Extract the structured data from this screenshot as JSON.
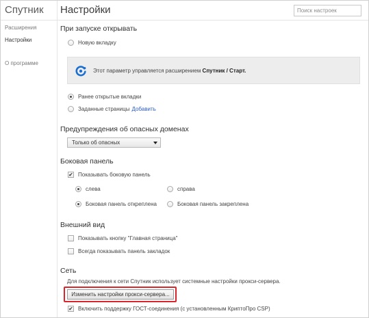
{
  "sidebar": {
    "brand": "Спутник",
    "items": [
      {
        "label": "Расширения"
      },
      {
        "label": "Настройки"
      }
    ],
    "about": "О программе"
  },
  "header": {
    "title": "Настройки",
    "search_placeholder": "Поиск настроек"
  },
  "startup": {
    "title": "При запуске открывать",
    "new_tab": "Новую вкладку",
    "notice_text": "Этот параметр управляется расширением",
    "notice_ext": "Спутник / Старт.",
    "prev_tabs": "Ранее открытые вкладки",
    "pages": "Заданные страницы",
    "pages_link": "Добавить",
    "selected": "prev_tabs"
  },
  "danger": {
    "title": "Предупреждения об опасных доменах",
    "select_value": "Только об опасных"
  },
  "side_panel": {
    "title": "Боковая панель",
    "show": "Показывать боковую панель",
    "show_checked": true,
    "left": "слева",
    "right": "справа",
    "detached": "Боковая панель откреплена",
    "pinned": "Боковая панель закреплена"
  },
  "appearance": {
    "title": "Внешний вид",
    "home_button": "Показывать кнопку \"Главная страница\"",
    "bookmarks": "Всегда показывать панель закладок"
  },
  "network": {
    "title": "Сеть",
    "info": "Для подключения к сети Спутник использует системные настройки прокси-сервера.",
    "proxy_button": "Изменить настройки прокси-сервера...",
    "gost": "Включить поддержку ГОСТ-соединения (с установленным КриптоПро CSP)",
    "gost_checked": true
  },
  "colors": {
    "link": "#2b5bc4",
    "highlight": "#d9262c",
    "notice_icon": "#1a6fd0"
  }
}
